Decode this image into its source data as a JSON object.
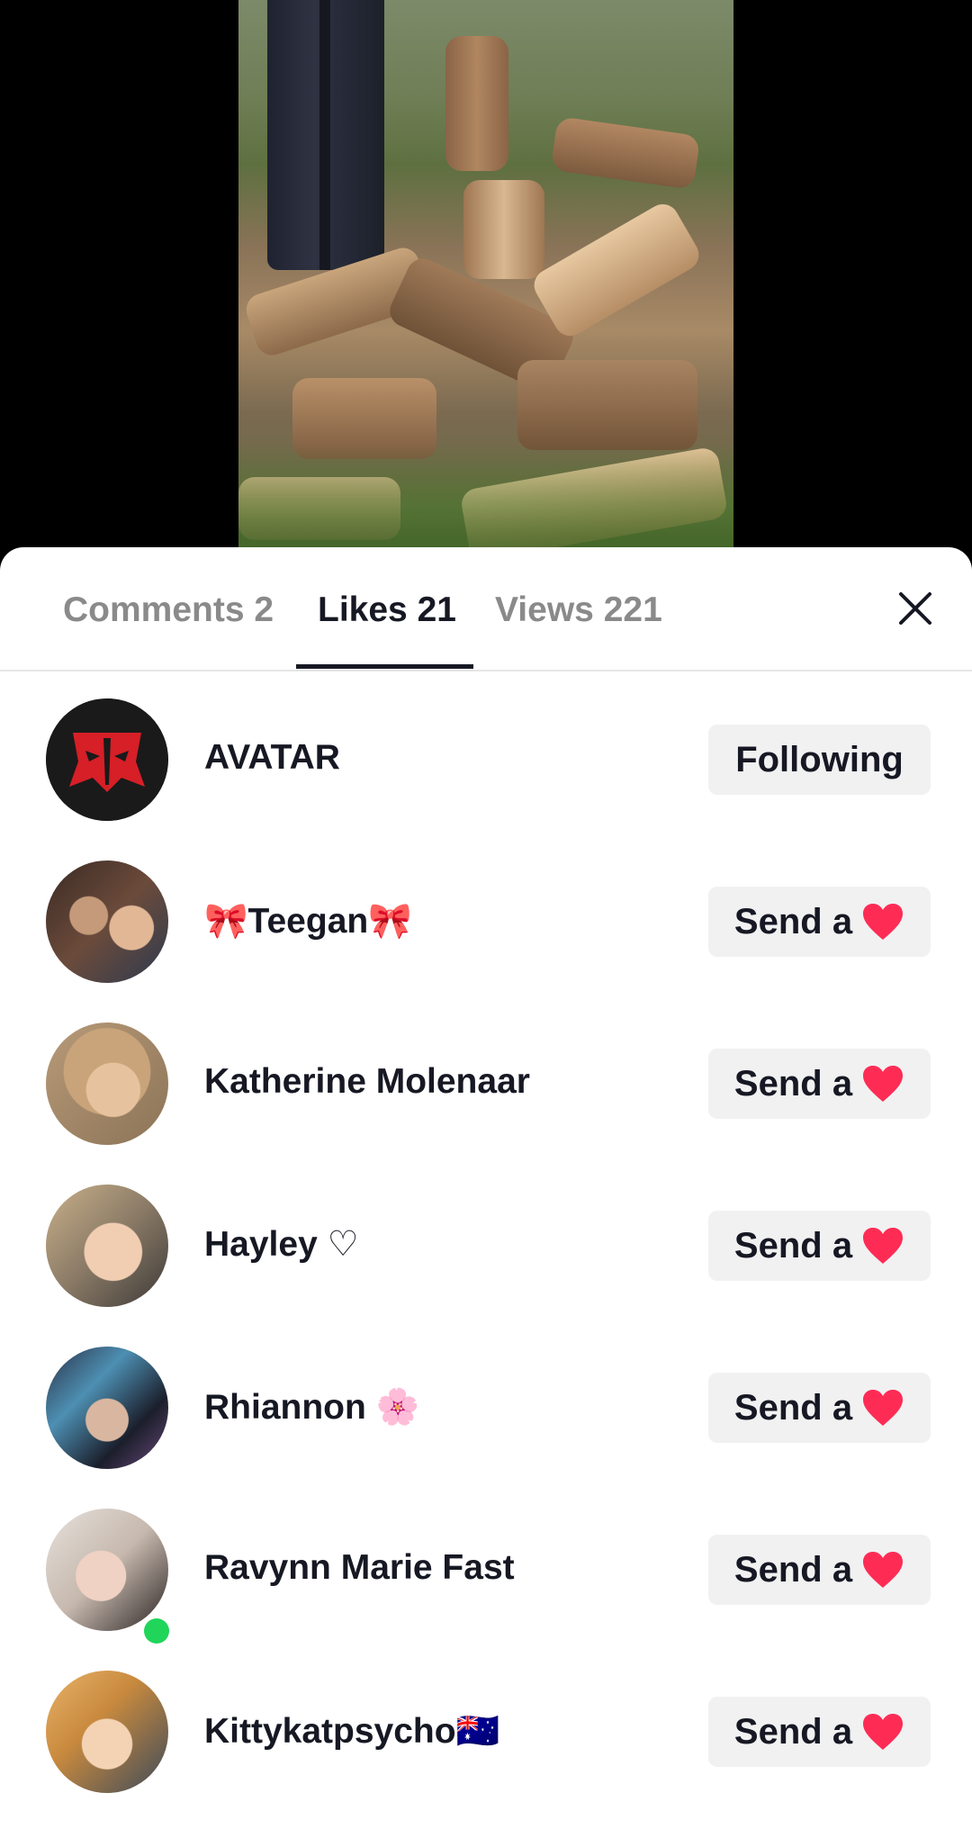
{
  "tabs": {
    "comments": "Comments 2",
    "likes": "Likes 21",
    "views": "Views 221",
    "active": "likes"
  },
  "colors": {
    "heart": "#fe2c55",
    "online": "#20d55a",
    "button_bg": "#f1f1f2",
    "text": "#161823"
  },
  "likes_list": [
    {
      "name": "AVATAR",
      "action": "Following",
      "avatar": "red-mask-avatar"
    },
    {
      "name": "🎀Teegan🎀",
      "action": "Send a",
      "avatar": "photo-avatar"
    },
    {
      "name": "Katherine Molenaar",
      "action": "Send a",
      "avatar": "photo-avatar"
    },
    {
      "name": "Hayley ♡",
      "action": "Send a",
      "avatar": "photo-avatar"
    },
    {
      "name": "Rhiannon 🌸",
      "action": "Send a",
      "avatar": "photo-avatar"
    },
    {
      "name": "Ravynn Marie Fast",
      "action": "Send a",
      "avatar": "photo-avatar",
      "online": true
    },
    {
      "name": "Kittykatpsycho🇦🇺",
      "action": "Send a",
      "avatar": "photo-avatar"
    }
  ]
}
